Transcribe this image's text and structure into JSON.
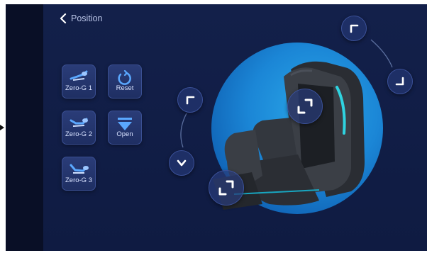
{
  "header": {
    "back_label": "Position"
  },
  "presets": [
    {
      "label": "Zero-G 1"
    },
    {
      "label": "Reset"
    },
    {
      "label": "Zero-G 2"
    },
    {
      "label": "Open"
    },
    {
      "label": "Zero-G 3"
    }
  ],
  "icons": {
    "back": "chevron-left-icon",
    "zero_g": "recliner-chair-icon",
    "reset": "reset-icon",
    "open": "open-triangle-icon",
    "backrest_up": "corner-arrow-icon",
    "backrest_down": "corner-arrow-icon",
    "legrest_up": "corner-arrow-icon",
    "legrest_down": "chevron-down-icon",
    "seat_adjust": "expand-arrows-icon",
    "foot_adjust": "expand-arrows-icon"
  },
  "colors": {
    "background": "#0f1a3d",
    "button": "#24366e",
    "accent_glow": "#1b86d6",
    "icon_blue": "#5aa8ff"
  }
}
